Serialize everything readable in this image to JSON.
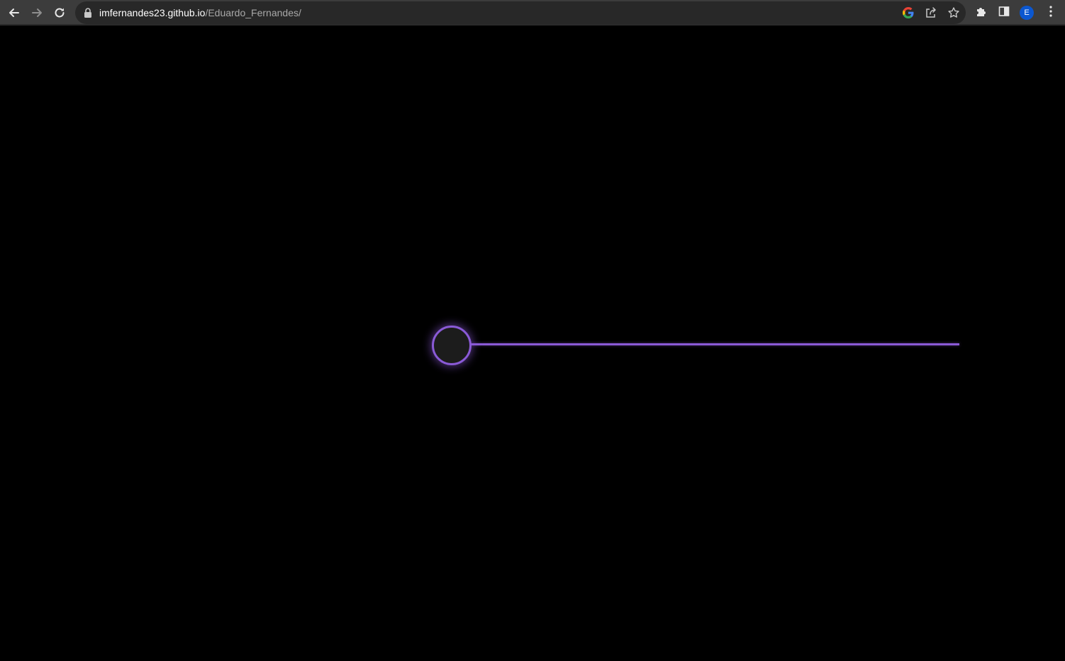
{
  "browser": {
    "url_host": "imfernandes23.github.io",
    "url_path": "/Eduardo_Fernandes/",
    "profile_initial": "E",
    "icons": {
      "back": "arrow-left-icon",
      "forward": "arrow-right-icon",
      "reload": "reload-icon",
      "lock": "lock-icon",
      "google": "google-icon",
      "share": "share-icon",
      "bookmark": "star-icon",
      "extensions": "puzzle-icon",
      "side_panel": "side-panel-icon",
      "menu": "kebab-menu-icon"
    },
    "colors": {
      "toolbar": "#3c3c3c",
      "omnibox": "#282828",
      "avatar": "#0b57d0"
    }
  },
  "page": {
    "background": "#000000",
    "accent": "#8a5ad6",
    "slider_value_fraction": 0.0
  }
}
